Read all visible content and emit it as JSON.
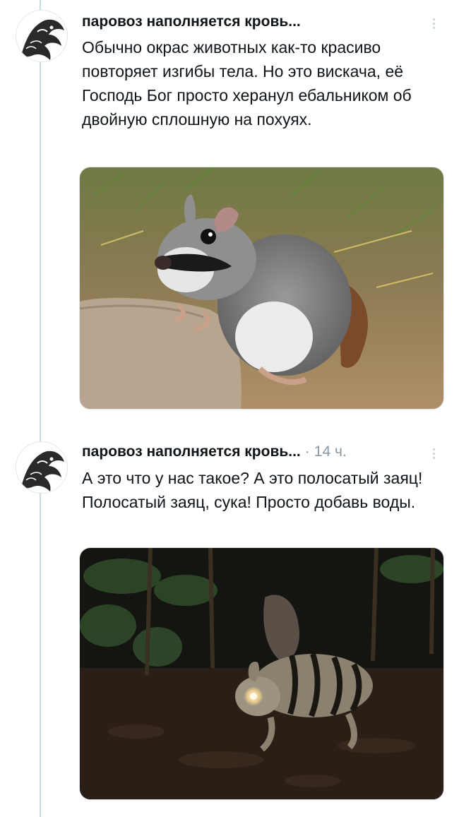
{
  "tweets": [
    {
      "author": "паровоз наполняется кровь...",
      "timestamp": "",
      "text": "Обычно окрас животных как-то красиво повторяет изгибы тела. Но это вискача, её Господь Бог просто херанул ебальником об двойную сплошную на похуях.",
      "avatar_icon": "dragon-avatar-icon",
      "media_subject": "viscacha-photo"
    },
    {
      "author": "паровоз наполняется кровь...",
      "timestamp": "14 ч.",
      "text": "А это что у нас такое? А это полосатый заяц! Полосатый заяц, сука! Просто добавь воды.",
      "avatar_icon": "dragon-avatar-icon",
      "media_subject": "striped-rabbit-night-photo"
    }
  ],
  "colors": {
    "text_primary": "#0f1419",
    "text_secondary": "#8899a6",
    "thread_line": "#cfd9de",
    "background": "#ffffff"
  }
}
